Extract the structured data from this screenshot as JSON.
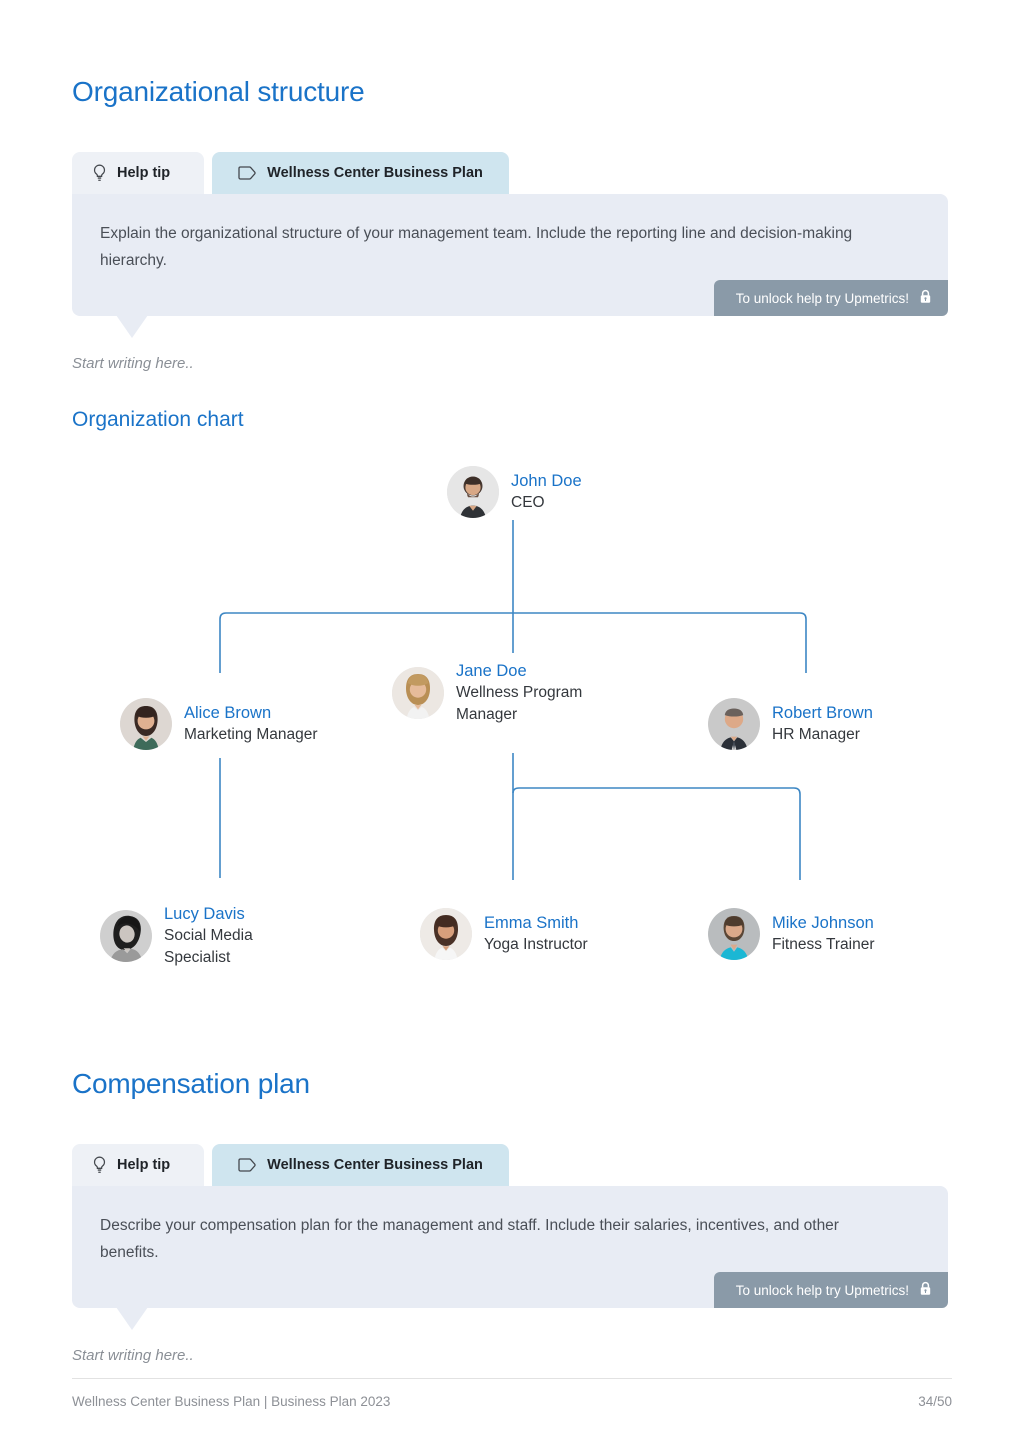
{
  "theme": {
    "heading_blue": "#1a73c8",
    "tip_bg": "#e8ecf4",
    "tab_help_bg": "#eef1f6",
    "tab_plan_bg": "#cfe5ef",
    "unlock_bg": "#8a9aa8",
    "connector": "#3d87c4"
  },
  "sections": {
    "org": {
      "title": "Organizational structure",
      "tabs": {
        "help_label": "Help tip",
        "plan_label": "Wellness Center Business Plan",
        "help_icon": "lightbulb-icon",
        "plan_icon": "tag-icon"
      },
      "tip_text": "Explain the organizational structure of your management team. Include the reporting line and decision-making hierarchy.",
      "unlock_label": "To unlock help try Upmetrics!",
      "unlock_icon": "lock-icon",
      "placeholder": "Start writing here.."
    },
    "chart_heading": "Organization chart",
    "compensation": {
      "title": "Compensation plan",
      "tabs": {
        "help_label": "Help tip",
        "plan_label": "Wellness Center Business Plan",
        "help_icon": "lightbulb-icon",
        "plan_icon": "tag-icon"
      },
      "tip_text": "Describe your compensation plan for the management and staff. Include their salaries, incentives, and other benefits.",
      "unlock_label": "To unlock help try Upmetrics!",
      "unlock_icon": "lock-icon",
      "placeholder": "Start writing here.."
    }
  },
  "chart_data": {
    "type": "diagram",
    "title": "Organization chart",
    "nodes": [
      {
        "id": "ceo",
        "name": "John Doe",
        "role": "CEO",
        "level": 0
      },
      {
        "id": "mkt",
        "name": "Alice Brown",
        "role": "Marketing Manager",
        "level": 1
      },
      {
        "id": "well",
        "name": "Jane Doe",
        "role": "Wellness Program Manager",
        "level": 1
      },
      {
        "id": "hr",
        "name": "Robert Brown",
        "role": "HR Manager",
        "level": 1
      },
      {
        "id": "social",
        "name": "Lucy Davis",
        "role": "Social Media Specialist",
        "level": 2
      },
      {
        "id": "yoga",
        "name": "Emma Smith",
        "role": "Yoga Instructor",
        "level": 2
      },
      {
        "id": "fit",
        "name": "Mike Johnson",
        "role": "Fitness Trainer",
        "level": 2
      }
    ],
    "edges": [
      {
        "from": "ceo",
        "to": "mkt"
      },
      {
        "from": "ceo",
        "to": "well"
      },
      {
        "from": "ceo",
        "to": "hr"
      },
      {
        "from": "mkt",
        "to": "social"
      },
      {
        "from": "well",
        "to": "yoga"
      },
      {
        "from": "well",
        "to": "fit"
      }
    ]
  },
  "footer": {
    "left": "Wellness Center Business Plan | Business Plan 2023",
    "page": "34/50"
  }
}
